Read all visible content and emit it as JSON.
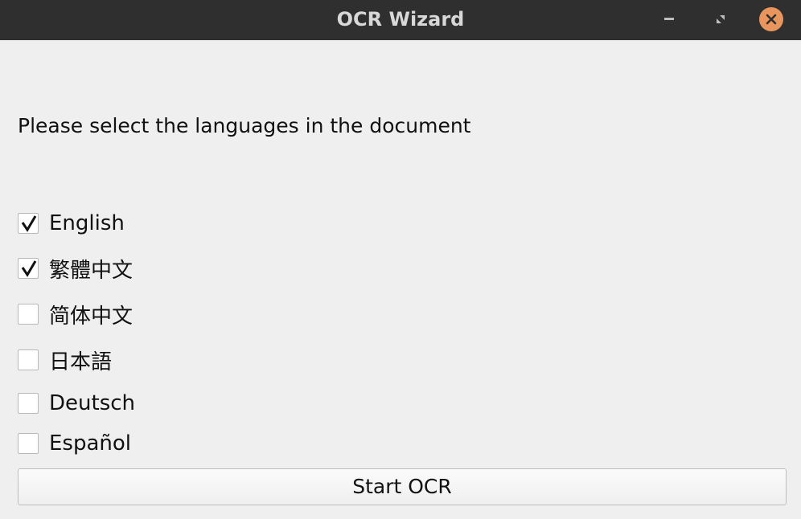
{
  "window": {
    "title": "OCR Wizard",
    "controls": {
      "minimize_icon": "minimize-icon",
      "maximize_icon": "restore-icon",
      "close_icon": "close-icon",
      "close_color": "#e9955e"
    }
  },
  "main": {
    "prompt": "Please select the languages in the document",
    "languages": [
      {
        "label": "English",
        "checked": true
      },
      {
        "label": "繁體中文",
        "checked": true
      },
      {
        "label": "简体中文",
        "checked": false
      },
      {
        "label": "日本語",
        "checked": false
      },
      {
        "label": "Deutsch",
        "checked": false
      },
      {
        "label": "Español",
        "checked": false
      }
    ],
    "start_button_label": "Start OCR"
  },
  "colors": {
    "titlebar": "#2f2f2f",
    "background": "#efefef",
    "accent": "#e9955e"
  }
}
